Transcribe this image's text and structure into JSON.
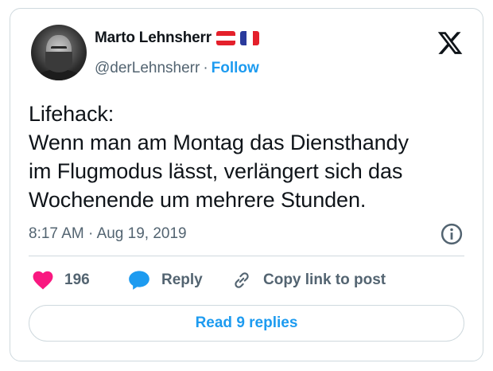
{
  "author": {
    "name": "Marto Lehnsherr",
    "handle": "@derLehnsherr",
    "separator": "·",
    "follow_label": "Follow",
    "flags": [
      "flag-austria-icon",
      "flag-france-icon"
    ]
  },
  "tweet": {
    "lines": [
      "Lifehack:",
      "Wenn man am Montag das Diensthandy",
      "im Flugmodus lässt, verlängert sich das",
      "Wochenende um mehrere Stunden."
    ],
    "time": "8:17 AM",
    "meta_separator": "·",
    "date": "Aug 19, 2019"
  },
  "actions": {
    "like_count": "196",
    "reply_label": "Reply",
    "copy_label": "Copy link to post"
  },
  "footer": {
    "read_replies_label": "Read 9 replies"
  },
  "colors": {
    "accent": "#1d9bf0",
    "like": "#f91880",
    "text": "#0f1419",
    "muted": "#536471",
    "border": "#cfd9de"
  },
  "icons": {
    "platform": "x-logo-icon",
    "info": "info-icon",
    "like": "heart-icon",
    "reply": "speech-bubble-icon",
    "copy": "link-icon"
  }
}
